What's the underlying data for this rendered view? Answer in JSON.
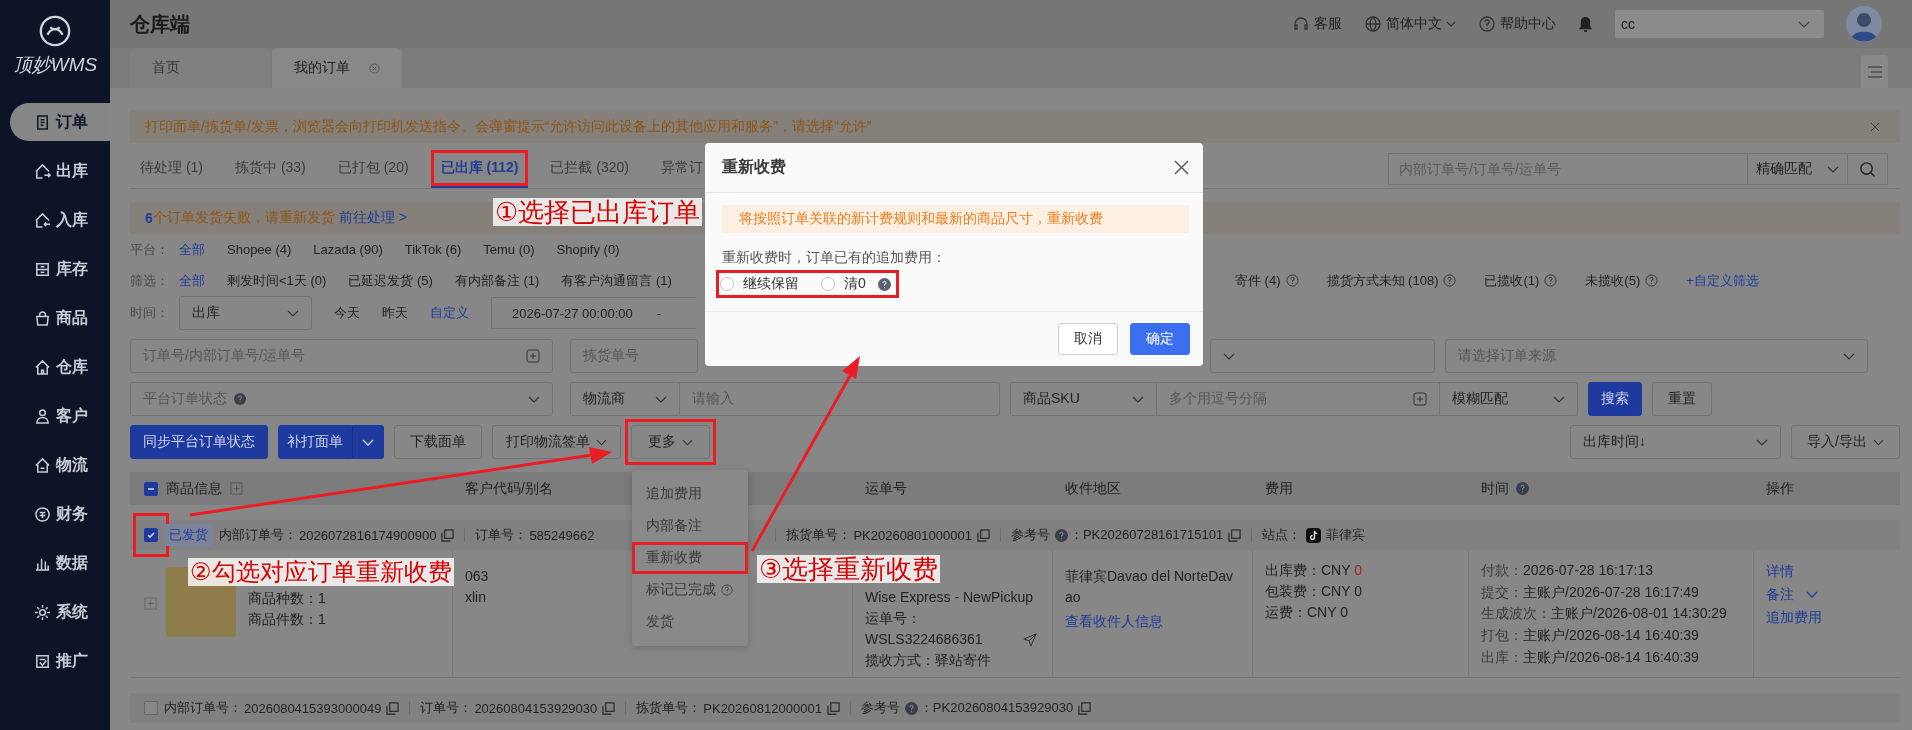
{
  "sidebar": {
    "logo": "顶妙WMS",
    "items": [
      {
        "label": "订单",
        "selected": true
      },
      {
        "label": "出库",
        "selected": false
      },
      {
        "label": "入库",
        "selected": false
      },
      {
        "label": "库存",
        "selected": false
      },
      {
        "label": "商品",
        "selected": false
      },
      {
        "label": "仓库",
        "selected": false
      },
      {
        "label": "客户",
        "selected": false
      },
      {
        "label": "物流",
        "selected": false
      },
      {
        "label": "财务",
        "selected": false
      },
      {
        "label": "数据",
        "selected": false
      },
      {
        "label": "系统",
        "selected": false
      },
      {
        "label": "推广",
        "selected": false
      }
    ]
  },
  "header": {
    "title": "仓库端",
    "links": [
      {
        "label": "客服",
        "dropdown": false
      },
      {
        "label": "简体中文",
        "dropdown": true
      },
      {
        "label": "帮助中心",
        "dropdown": false
      }
    ],
    "account": "cc"
  },
  "page_tabs": [
    {
      "label": "首页",
      "selected": false,
      "closable": false
    },
    {
      "label": "我的订单",
      "selected": true,
      "closable": true
    }
  ],
  "notice": "打印面单/拣货单/发票，浏览器会向打印机发送指令。会弹窗提示“允许访问此设备上的其他应用和服务”，请选择“允许”",
  "status_tabs": [
    {
      "label": "待处理 (1)",
      "selected": false,
      "highlighted": false
    },
    {
      "label": "拣货中 (33)",
      "selected": false,
      "highlighted": false
    },
    {
      "label": "已打包 (20)",
      "selected": false,
      "highlighted": false
    },
    {
      "label": "已出库 (112)",
      "selected": true,
      "highlighted": true
    },
    {
      "label": "已拦截 (320)",
      "selected": false,
      "highlighted": false
    },
    {
      "label": "异常订",
      "selected": false,
      "highlighted": false
    }
  ],
  "quick_search": {
    "placeholder": "内部订单号/订单号/运单号",
    "match": "精确匹配"
  },
  "failure_bar": {
    "count": "6",
    "message": "个订单发货失败，请重新发货",
    "link": "前往处理 >"
  },
  "platform_filter": {
    "label": "平台：",
    "options": [
      {
        "label": "全部",
        "selected": true
      },
      {
        "label": "Shopee (4)",
        "selected": false
      },
      {
        "label": "Lazada (90)",
        "selected": false
      },
      {
        "label": "TikTok (6)",
        "selected": false
      },
      {
        "label": "Temu (0)",
        "selected": false
      },
      {
        "label": "Shopify (0)",
        "selected": false
      }
    ]
  },
  "quick_filter": {
    "label": "筛选：",
    "options": [
      {
        "label": "全部",
        "selected": true
      },
      {
        "label": "剩发时间<1天 (0)",
        "selected": false
      },
      {
        "label": "已延迟发货 (5)",
        "selected": false
      },
      {
        "label": "有内部备注 (1)",
        "selected": false
      },
      {
        "label": "有客户沟通留言 (1)",
        "selected": false
      }
    ],
    "more_options": [
      {
        "label": "寄件 (4)",
        "selected": false,
        "help": true
      },
      {
        "label": "揽货方式未知 (108)",
        "selected": false,
        "help": true
      },
      {
        "label": "已揽收(1)",
        "selected": false,
        "help": true
      },
      {
        "label": "未揽收(5)",
        "selected": false,
        "help": true
      }
    ],
    "custom_link": "+自定义筛选"
  },
  "time_filter": {
    "label": "时间：",
    "field": "出库",
    "options": [
      {
        "label": "今天",
        "selected": false
      },
      {
        "label": "昨天",
        "selected": false
      },
      {
        "label": "自定义",
        "selected": true
      }
    ],
    "start": "2026-07-27 00:00:00",
    "separator": "-"
  },
  "search_row_1": {
    "order_field": "订单号/内部订单号/运单号",
    "picking_field": "拣货单号",
    "source_select": "请选择订单来源"
  },
  "search_row_2": {
    "status_select": "平台订单状态",
    "carrier_select": "物流商",
    "carrier_input": "请输入",
    "sku_select": "商品SKU",
    "sku_input": "多个用逗号分隔",
    "match_select": "模糊匹配",
    "search_button": "搜索",
    "reset_button": "重置"
  },
  "actions": {
    "buttons": [
      {
        "label": "同步平台订单状态",
        "kind": "primary",
        "highlighted": false
      },
      {
        "label": "补打面单",
        "kind": "split",
        "highlighted": false
      },
      {
        "label": "下载面单",
        "kind": "plain",
        "highlighted": false
      },
      {
        "label": "打印物流签单",
        "kind": "dropdown",
        "highlighted": false
      },
      {
        "label": "更多",
        "kind": "menu",
        "highlighted": true
      }
    ],
    "sort": "出库时间↓",
    "export": "导入/导出"
  },
  "more_menu": [
    {
      "label": "追加费用",
      "help": false,
      "highlighted": false
    },
    {
      "label": "内部备注",
      "help": false,
      "highlighted": false
    },
    {
      "label": "重新收费",
      "help": false,
      "highlighted": true
    },
    {
      "label": "标记已完成",
      "help": true,
      "highlighted": false
    },
    {
      "label": "发货",
      "help": false,
      "highlighted": false
    }
  ],
  "table": {
    "select_all": {
      "indeterminate": true
    },
    "columns": [
      {
        "label": "商品信息",
        "expand": true,
        "help": false
      },
      {
        "label": "客户代码/别名",
        "expand": false,
        "help": false
      },
      {
        "label": "运单号",
        "expand": false,
        "help": false
      },
      {
        "label": "收件地区",
        "expand": false,
        "help": false
      },
      {
        "label": "费用",
        "expand": false,
        "help": false
      },
      {
        "label": "时间",
        "expand": false,
        "help": true
      },
      {
        "label": "操作",
        "expand": false,
        "help": false
      }
    ]
  },
  "orders": [
    {
      "checked": true,
      "highlighted": true,
      "status": "已发货",
      "summary": [
        {
          "kind": "text",
          "label": "内部订单号：",
          "value": "2026072816174900900",
          "copy": true,
          "help": false,
          "covered": false
        },
        {
          "kind": "text",
          "label": "订单号：",
          "value": "585249662",
          "copy": false,
          "help": false,
          "covered": true
        },
        {
          "kind": "text",
          "label": "拣货单号：",
          "value": "PK20260801000001",
          "copy": true,
          "help": false,
          "covered": false
        },
        {
          "kind": "text",
          "label": "参考号",
          "value": "：PK20260728161715101",
          "copy": true,
          "help": true,
          "covered": false
        },
        {
          "kind": "site",
          "label": "站点：",
          "value": "菲律宾",
          "copy": false,
          "help": false,
          "covered": false
        }
      ],
      "details": {
        "product": [
          "商品种数：1",
          "商品件数：1"
        ],
        "customer": [
          "063",
          "xlin"
        ],
        "waybill": {
          "carrier": "Wise Express - NewPickup",
          "number_label": "运单号：",
          "number": "WSLS3224686361",
          "pickup": "揽收方式：驿站寄件"
        },
        "region": {
          "address": "菲律宾Davao del NorteDavao",
          "link": "查看收件人信息"
        },
        "fees": [
          {
            "label": "出库费：",
            "currency": "CNY",
            "amount": "0",
            "alert": true
          },
          {
            "label": "包装费：",
            "currency": "CNY",
            "amount": "0",
            "alert": false
          },
          {
            "label": "运费：",
            "currency": "CNY",
            "amount": "0",
            "alert": false
          }
        ],
        "times": [
          {
            "label": "付款：",
            "value": "2026-07-28 16:17:13"
          },
          {
            "label": "提交：",
            "value": "主账户/2026-07-28 16:17:49"
          },
          {
            "label": "生成波次：",
            "value": "主账户/2026-08-01 14:30:29"
          },
          {
            "label": "打包：",
            "value": "主账户/2026-08-14 16:40:39"
          },
          {
            "label": "出库：",
            "value": "主账户/2026-08-14 16:40:39"
          }
        ],
        "ops": [
          {
            "label": "详情",
            "dropdown": false
          },
          {
            "label": "备注",
            "dropdown": true
          },
          {
            "label": "追加费用",
            "dropdown": false
          }
        ]
      }
    },
    {
      "checked": false,
      "highlighted": false,
      "summary": [
        {
          "kind": "text",
          "label": "内部订单号：",
          "value": "2026080415393000049",
          "copy": true,
          "help": false,
          "covered": false
        },
        {
          "kind": "text",
          "label": "订单号：",
          "value": "20260804153929030",
          "copy": true,
          "help": false,
          "covered": false
        },
        {
          "kind": "text",
          "label": "拣货单号：",
          "value": "PK20260812000001",
          "copy": true,
          "help": false,
          "covered": false
        },
        {
          "kind": "text",
          "label": "参考号",
          "value": "：PK20260804153929030",
          "copy": true,
          "help": true,
          "covered": false
        }
      ]
    }
  ],
  "modal": {
    "title": "重新收费",
    "notice": "将按照订单关联的新计费规则和最新的商品尺寸，重新收费",
    "question": "重新收费时，订单已有的追加费用：",
    "options_highlighted": true,
    "options": [
      {
        "label": "继续保留",
        "selected": false,
        "help": false
      },
      {
        "label": "清0",
        "selected": false,
        "help": true
      }
    ],
    "buttons": [
      {
        "label": "取消",
        "kind": "secondary"
      },
      {
        "label": "确定",
        "kind": "primary"
      }
    ]
  },
  "annotations": [
    "①选择已出库订单",
    "②勾选对应订单重新收费",
    "③选择重新收费"
  ]
}
